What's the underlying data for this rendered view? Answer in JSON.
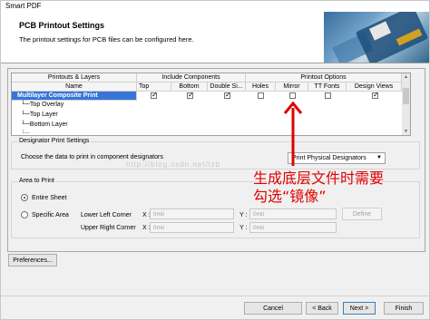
{
  "window": {
    "title": "Smart PDF"
  },
  "header": {
    "title": "PCB Printout Settings",
    "subtitle": "The printout settings for PCB files can be configured here."
  },
  "grid": {
    "group_headers": [
      "Printouts & Layers",
      "Include Components",
      "Printout Options"
    ],
    "columns": [
      "Name",
      "Top",
      "Bottom",
      "Double Si...",
      "Holes",
      "Mirror",
      "TT Fonts",
      "Design Views"
    ],
    "rows": [
      {
        "name": "Multilayer Composite Print",
        "top": true,
        "bottom": true,
        "double": true,
        "holes": false,
        "mirror": false,
        "ttfonts": false,
        "views": true
      },
      {
        "name": "Top Overlay"
      },
      {
        "name": "Top Layer"
      },
      {
        "name": "Bottom Layer"
      }
    ]
  },
  "designator": {
    "legend": "Designator Print Settings",
    "prompt": "Choose the data to print in component designators",
    "selected": "Print Physical Designators"
  },
  "area": {
    "legend": "Area to Print",
    "entire_sheet": "Entire Sheet",
    "specific_area": "Specific Area",
    "lower_left": "Lower Left Corner",
    "upper_right": "Upper Right Corner",
    "x_label": "X :",
    "y_label": "Y :",
    "placeholder": "0mil",
    "define_button": "Define"
  },
  "preferences_button": "Preferences...",
  "footer": {
    "cancel": "Cancel",
    "back": "< Back",
    "next": "Next >",
    "finish": "Finish"
  },
  "watermark": "http://blog.csdn.net/lzb",
  "annotation": {
    "line1": "生成底层文件时需要",
    "line2": "勾选“镜像”",
    "color": "#e00000"
  },
  "colors": {
    "selection": "#3875d7",
    "header_bg": "#ffffff",
    "dialog_bg": "#f0f0f0"
  }
}
